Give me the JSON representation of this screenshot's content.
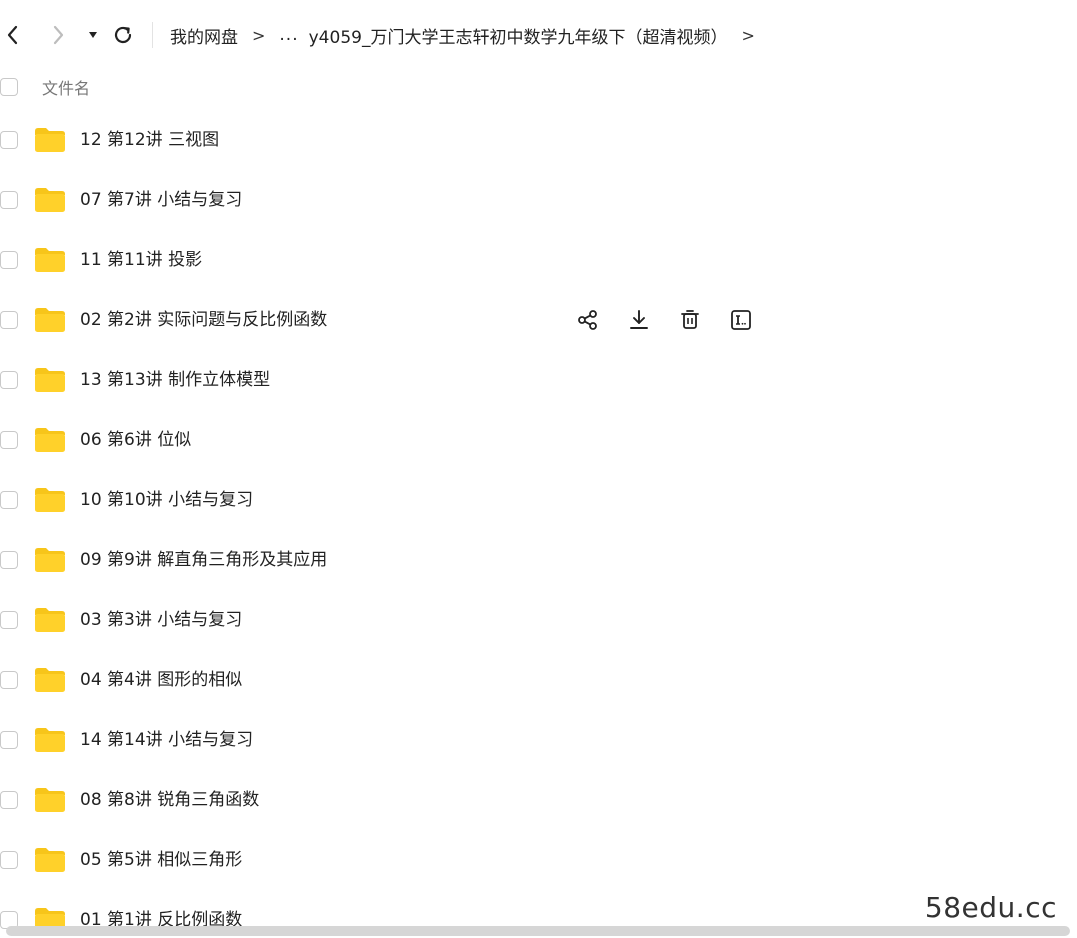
{
  "toolbar": {
    "back_icon": "chevron-left-icon",
    "forward_icon": "chevron-right-icon",
    "history_icon": "caret-down-icon",
    "refresh_icon": "refresh-icon"
  },
  "breadcrumb": {
    "root": "我的网盘",
    "separator": ">",
    "ellipsis": "...",
    "current": "y4059_万门大学王志轩初中数学九年级下（超清视频）",
    "trailing_separator": ">"
  },
  "list": {
    "header_label": "文件名",
    "rows": [
      {
        "name": "12 第12讲 三视图"
      },
      {
        "name": "07 第7讲 小结与复习"
      },
      {
        "name": "11 第11讲 投影"
      },
      {
        "name": "02 第2讲 实际问题与反比例函数"
      },
      {
        "name": "13 第13讲 制作立体模型"
      },
      {
        "name": "06 第6讲 位似"
      },
      {
        "name": "10 第10讲 小结与复习"
      },
      {
        "name": "09 第9讲 解直角三角形及其应用"
      },
      {
        "name": "03 第3讲 小结与复习"
      },
      {
        "name": "04 第4讲 图形的相似"
      },
      {
        "name": "14 第14讲 小结与复习"
      },
      {
        "name": "08 第8讲 锐角三角函数"
      },
      {
        "name": "05 第5讲 相似三角形"
      },
      {
        "name": "01 第1讲 反比例函数"
      }
    ],
    "hovered_row_actions": [
      "share-icon",
      "download-icon",
      "delete-icon",
      "rename-icon"
    ]
  },
  "watermark": "58edu.cc",
  "colors": {
    "folder": "#ffd12a",
    "folder_tab": "#f7c51a",
    "text": "#222222",
    "muted": "#777777"
  }
}
